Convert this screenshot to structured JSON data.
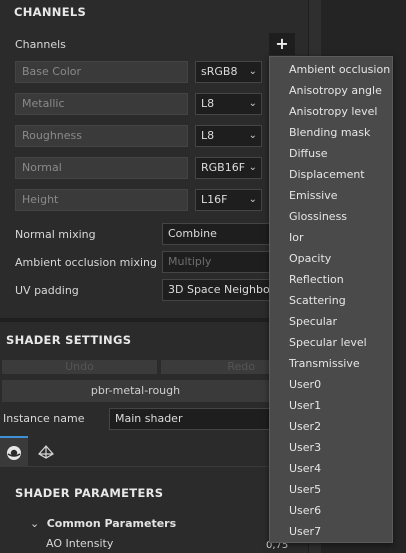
{
  "channels": {
    "title": "CHANNELS",
    "list_label": "Channels",
    "add_symbol": "+",
    "rows": [
      {
        "name": "Base Color",
        "format": "sRGB8"
      },
      {
        "name": "Metallic",
        "format": "L8"
      },
      {
        "name": "Roughness",
        "format": "L8"
      },
      {
        "name": "Normal",
        "format": "RGB16F"
      },
      {
        "name": "Height",
        "format": "L16F"
      }
    ],
    "normal_mixing": {
      "label": "Normal mixing",
      "value": "Combine"
    },
    "ao_mixing": {
      "label": "Ambient occlusion mixing",
      "value": "Multiply"
    },
    "uv_padding": {
      "label": "UV padding",
      "value": "3D Space Neighbo"
    }
  },
  "shader_settings": {
    "title": "SHADER SETTINGS",
    "undo": "Undo",
    "redo": "Redo",
    "shader_name": "pbr-metal-rough",
    "instance_label": "Instance name",
    "instance_value": "Main shader"
  },
  "shader_parameters": {
    "title": "SHADER PARAMETERS",
    "group_label": "Common Parameters",
    "ao_label": "AO Intensity",
    "ao_value": "0,75"
  },
  "dropdown": {
    "items": [
      "Ambient occlusion",
      "Anisotropy angle",
      "Anisotropy level",
      "Blending mask",
      "Diffuse",
      "Displacement",
      "Emissive",
      "Glossiness",
      "Ior",
      "Opacity",
      "Reflection",
      "Scattering",
      "Specular",
      "Specular level",
      "Transmissive",
      "User0",
      "User1",
      "User2",
      "User3",
      "User4",
      "User5",
      "User6",
      "User7"
    ]
  },
  "icons": {
    "chevron": "chevron-down-icon",
    "add": "plus-icon",
    "tab1": "shader-ball-icon",
    "tab2": "pyramid-icon",
    "collapse": "chevron-down-icon"
  }
}
